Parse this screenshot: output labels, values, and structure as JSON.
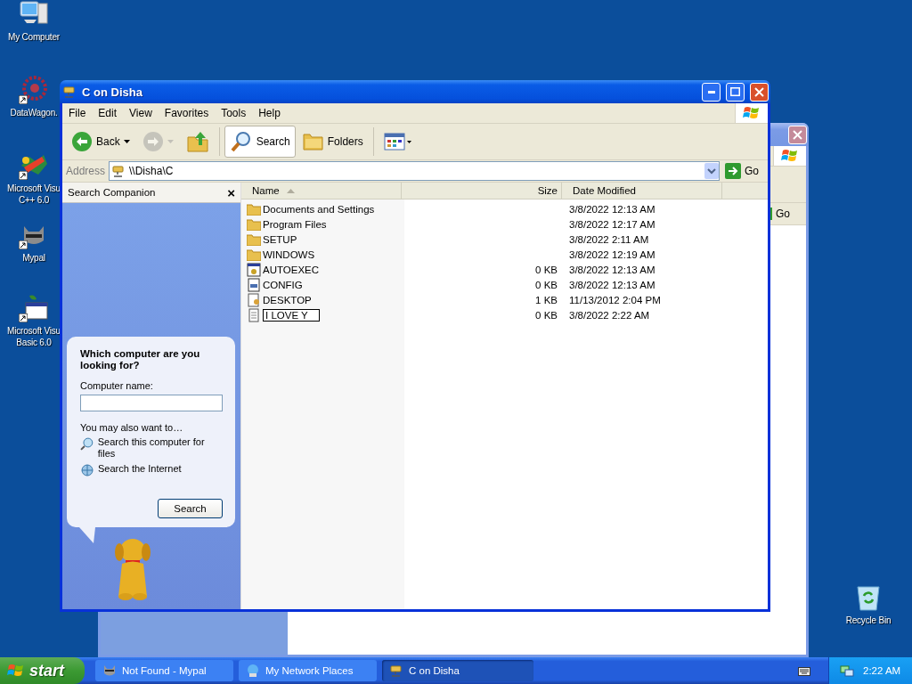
{
  "desktop_icons": [
    {
      "kind": "computer",
      "lines": [
        "My Computer"
      ],
      "shortcut": false
    },
    {
      "kind": "wheel",
      "lines": [
        "DataWagon."
      ],
      "shortcut": true
    },
    {
      "kind": "cpp",
      "lines": [
        "Microsoft Visu",
        "C++ 6.0"
      ],
      "shortcut": true
    },
    {
      "kind": "raccoon",
      "lines": [
        "Mypal"
      ],
      "shortcut": true
    },
    {
      "kind": "vb",
      "lines": [
        "Microsoft Visu",
        "Basic 6.0"
      ],
      "shortcut": true
    }
  ],
  "recycle_bin": {
    "label": "Recycle Bin"
  },
  "back_window": {
    "go_label": "Go"
  },
  "window": {
    "title": "C on Disha",
    "menu": [
      "File",
      "Edit",
      "View",
      "Favorites",
      "Tools",
      "Help"
    ],
    "toolbar": [
      {
        "kind": "back",
        "label": "Back",
        "disabled": false
      },
      {
        "kind": "forward",
        "disabled": true
      },
      {
        "kind": "up"
      },
      {
        "kind": "search",
        "label": "Search",
        "pressed": true
      },
      {
        "kind": "folders",
        "label": "Folders",
        "pressed": false
      },
      {
        "kind": "views"
      }
    ],
    "address": {
      "label": "Address",
      "value": "\\\\Disha\\C",
      "go_label": "Go"
    },
    "search_companion": {
      "title": "Search Companion",
      "close": "×",
      "question": "Which computer are you looking for?",
      "field_label": "Computer name:",
      "also_label": "You may also want to…",
      "links": [
        {
          "kind": "computer",
          "label": "Search this computer for files"
        },
        {
          "kind": "internet",
          "label": "Search the Internet"
        }
      ],
      "button": "Search"
    },
    "columns": [
      {
        "label": "Name",
        "sorted": true
      },
      {
        "label": "Size",
        "sorted": false
      },
      {
        "label": "Date Modified",
        "sorted": false
      }
    ],
    "rows": [
      {
        "kind": "folder",
        "name": "Documents and Settings",
        "date": "3/8/2022 12:13 AM",
        "editing": false
      },
      {
        "kind": "folder",
        "name": "Program Files",
        "date": "3/8/2022 12:17 AM",
        "editing": false
      },
      {
        "kind": "folder",
        "name": "SETUP",
        "date": "3/8/2022 2:11 AM",
        "editing": false
      },
      {
        "kind": "folder",
        "name": "WINDOWS",
        "date": "3/8/2022 12:19 AM",
        "editing": false
      },
      {
        "kind": "batch",
        "name": "AUTOEXEC",
        "size": "0 KB",
        "date": "3/8/2022 12:13 AM",
        "editing": false
      },
      {
        "kind": "config",
        "name": "CONFIG",
        "size": "0 KB",
        "date": "3/8/2022 12:13 AM",
        "editing": false
      },
      {
        "kind": "desktop",
        "name": "DESKTOP",
        "size": "1 KB",
        "date": "11/13/2012 2:04 PM",
        "editing": false
      },
      {
        "kind": "text",
        "name": "I LOVE Y",
        "size": "0 KB",
        "date": "3/8/2022 2:22 AM",
        "editing": true
      }
    ]
  },
  "taskbar": {
    "start": "start",
    "tasks": [
      {
        "kind": "raccoon",
        "label": "Not Found - Mypal",
        "selected": false
      },
      {
        "kind": "network",
        "label": "My Network Places",
        "selected": false
      },
      {
        "kind": "share",
        "label": "C on Disha",
        "selected": true
      }
    ],
    "time": "2:22 AM"
  }
}
